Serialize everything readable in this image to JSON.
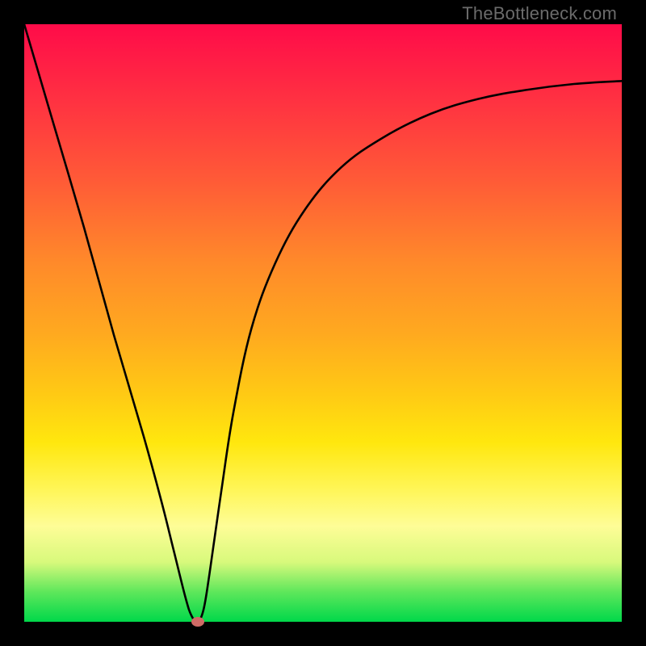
{
  "watermark": "TheBottleneck.com",
  "chart_data": {
    "type": "line",
    "title": "",
    "xlabel": "",
    "ylabel": "",
    "xlim": [
      0,
      100
    ],
    "ylim": [
      0,
      100
    ],
    "grid": false,
    "series": [
      {
        "name": "curve",
        "x": [
          0,
          5,
          10,
          15,
          20,
          23,
          25,
          27,
          28,
          29,
          30,
          31,
          33,
          35,
          38,
          42,
          47,
          53,
          60,
          68,
          76,
          84,
          92,
          100
        ],
        "y": [
          100,
          83,
          66,
          48,
          31,
          20,
          12,
          4,
          1,
          0,
          2,
          8,
          22,
          35,
          49,
          60,
          69,
          76,
          81,
          85,
          87.5,
          89,
          90,
          90.5
        ]
      }
    ],
    "marker": {
      "x": 29,
      "y": 0
    },
    "gradient_stops": [
      {
        "pos": 0,
        "color": "#ff0b49"
      },
      {
        "pos": 12,
        "color": "#ff2f42"
      },
      {
        "pos": 26,
        "color": "#ff5a37"
      },
      {
        "pos": 40,
        "color": "#ff8a2a"
      },
      {
        "pos": 52,
        "color": "#ffaa1f"
      },
      {
        "pos": 62,
        "color": "#ffca14"
      },
      {
        "pos": 70,
        "color": "#ffe70e"
      },
      {
        "pos": 78,
        "color": "#fff659"
      },
      {
        "pos": 84,
        "color": "#fefd97"
      },
      {
        "pos": 90,
        "color": "#d8f97c"
      },
      {
        "pos": 95,
        "color": "#5ee75b"
      },
      {
        "pos": 100,
        "color": "#00d84a"
      }
    ]
  }
}
